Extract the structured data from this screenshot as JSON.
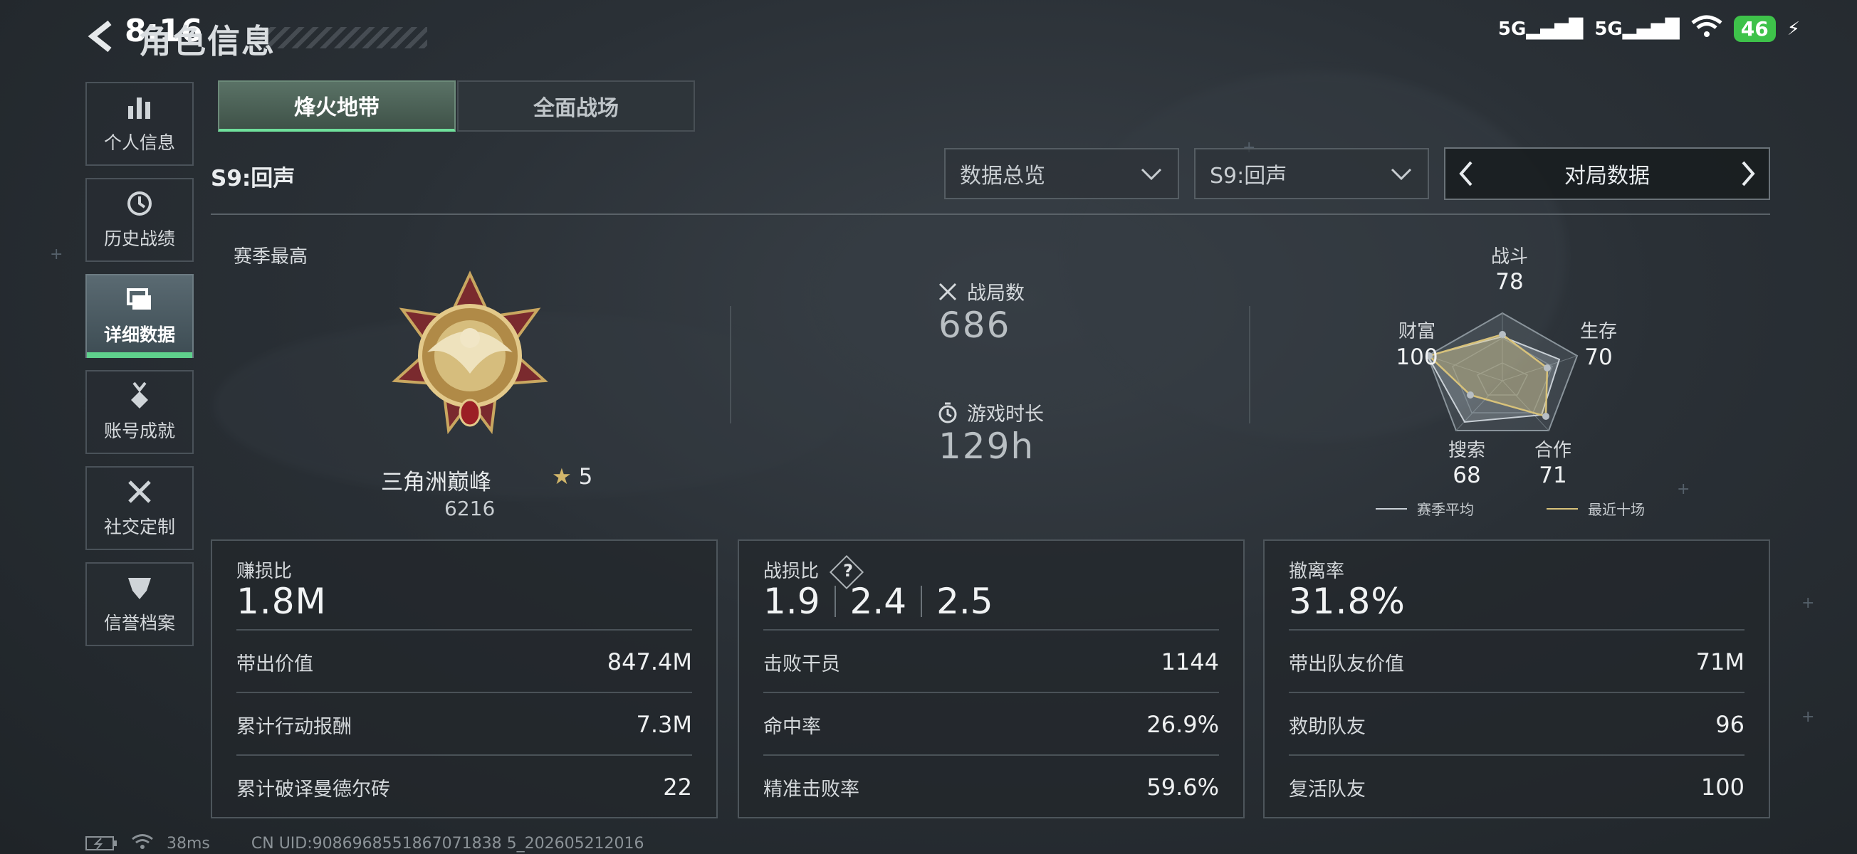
{
  "status_bar": {
    "time": "8:16",
    "signal_1": "5G",
    "signal_2": "5G",
    "battery": "46"
  },
  "page": {
    "title": "角色信息"
  },
  "sidebar": {
    "items": [
      {
        "label": "个人信息",
        "icon": "bar-chart-icon"
      },
      {
        "label": "历史战绩",
        "icon": "history-icon"
      },
      {
        "label": "详细数据",
        "icon": "cards-icon",
        "active": true
      },
      {
        "label": "账号成就",
        "icon": "medal-icon"
      },
      {
        "label": "社交定制",
        "icon": "tools-icon"
      },
      {
        "label": "信誉档案",
        "icon": "shield-icon"
      }
    ]
  },
  "tabs": [
    {
      "label": "烽火地带",
      "active": true
    },
    {
      "label": "全面战场",
      "active": false
    }
  ],
  "season": {
    "label": "S9:回声"
  },
  "filters": {
    "overview": "数据总览",
    "season": "S9:回声",
    "nav_label": "对局数据"
  },
  "rank": {
    "section_label": "赛季最高",
    "name": "三角洲巅峰",
    "stars": "5",
    "score": "6216"
  },
  "summary": {
    "matches_label": "战局数",
    "matches_value": "686",
    "playtime_label": "游戏时长",
    "playtime_value": "129h"
  },
  "radar": {
    "axes": [
      {
        "label": "战斗",
        "value": "78"
      },
      {
        "label": "生存",
        "value": "70"
      },
      {
        "label": "合作",
        "value": "71"
      },
      {
        "label": "搜索",
        "value": "68"
      },
      {
        "label": "财富",
        "value": "100"
      }
    ],
    "legend_season": "赛季平均",
    "legend_recent": "最近十场",
    "colors": {
      "season": "#c9d0d6",
      "recent": "#d8c27a"
    }
  },
  "cards": {
    "profit": {
      "label": "赚损比",
      "value": "1.8M",
      "rows": [
        {
          "k": "带出价值",
          "v": "847.4M"
        },
        {
          "k": "累计行动报酬",
          "v": "7.3M"
        },
        {
          "k": "累计破译曼德尔砖",
          "v": "22"
        }
      ]
    },
    "combat": {
      "label": "战损比",
      "help": "?",
      "ratios": [
        "1.9",
        "2.4",
        "2.5"
      ],
      "rows": [
        {
          "k": "击败干员",
          "v": "1144"
        },
        {
          "k": "命中率",
          "v": "26.9%"
        },
        {
          "k": "精准击败率",
          "v": "59.6%"
        }
      ]
    },
    "extract": {
      "label": "撤离率",
      "value": "31.8%",
      "rows": [
        {
          "k": "带出队友价值",
          "v": "71M"
        },
        {
          "k": "救助队友",
          "v": "96"
        },
        {
          "k": "复活队友",
          "v": "100"
        }
      ]
    }
  },
  "footer": {
    "ping": "38ms",
    "uid": "CN UID:9086968551867071838 5_202605212016"
  }
}
